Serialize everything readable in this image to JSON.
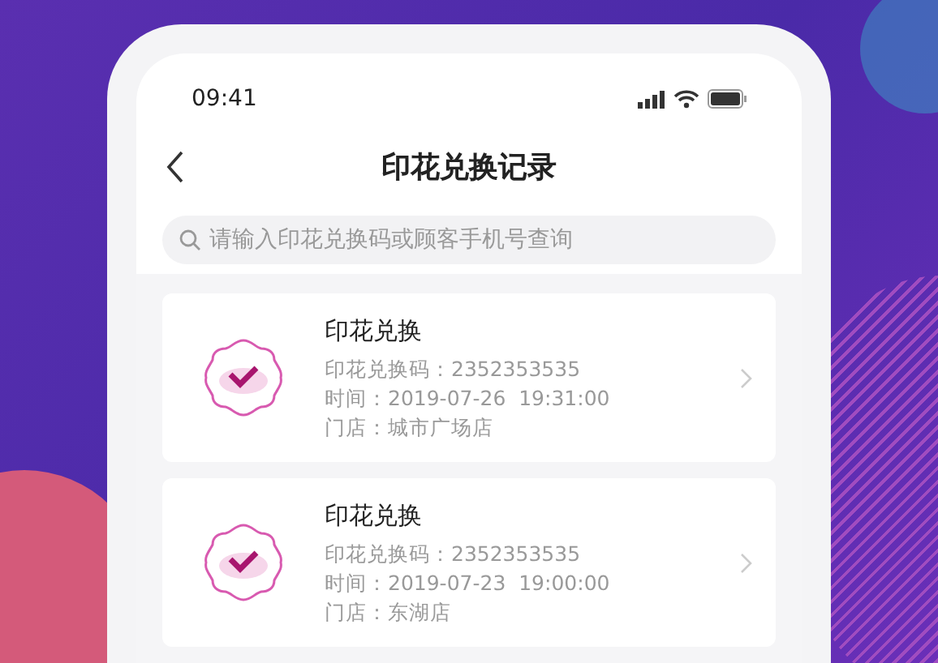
{
  "status_bar": {
    "time": "09:41"
  },
  "header": {
    "title": "印花兑换记录"
  },
  "search": {
    "placeholder": "请输入印花兑换码或顾客手机号查询"
  },
  "records": [
    {
      "title": "印花兑换",
      "code": "印花兑换码：2352353535",
      "time": "时间：2019-07-26  19:31:00",
      "store": "门店：城市广场店"
    },
    {
      "title": "印花兑换",
      "code": "印花兑换码：2352353535",
      "time": "时间：2019-07-23  19:00:00",
      "store": "门店：东湖店"
    }
  ]
}
